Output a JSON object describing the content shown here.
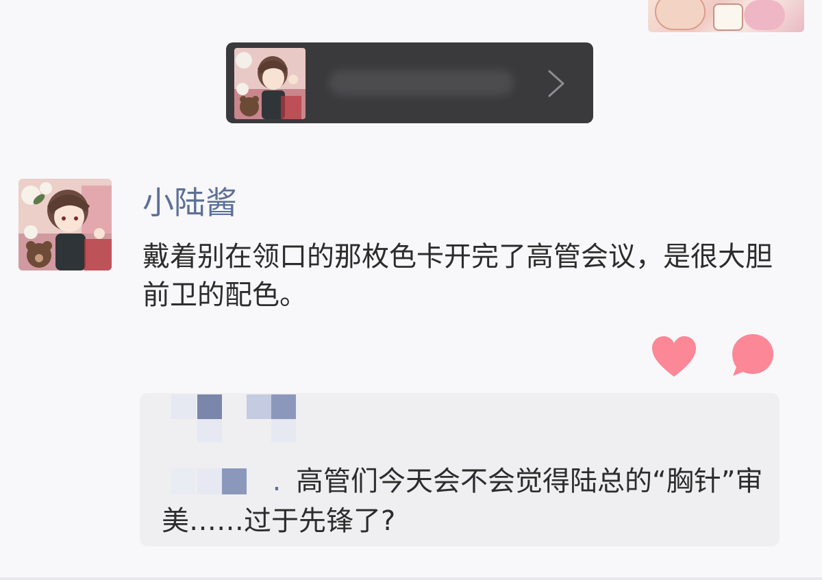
{
  "post": {
    "author": "小陆酱",
    "text": "戴着别在领口的那枚色卡开完了高管会议，是很大胆前卫的配色。"
  },
  "comment": {
    "dot": ".",
    "text": "高管们今天会不会觉得陆总的“胸针”审美……过于先锋了?"
  },
  "icons": {
    "like": "heart-icon",
    "comment": "comment-bubble-icon",
    "chevron": "chevron-right-icon"
  },
  "colors": {
    "accent": "#5c6f96",
    "icon": "#fb8797",
    "card_bg": "#3a3a3c"
  }
}
